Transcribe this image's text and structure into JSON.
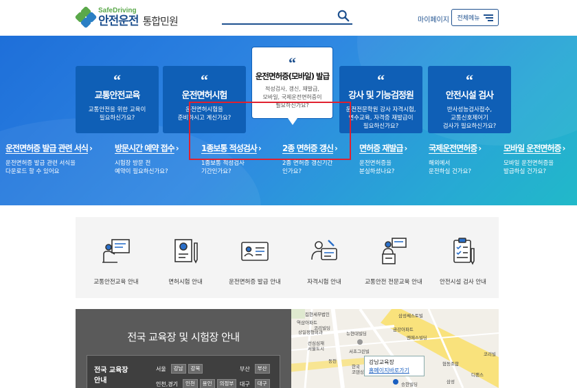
{
  "header": {
    "logo_en": "SafeDriving",
    "logo_ko": "안전운전",
    "logo_sub": "통합민원",
    "search_placeholder": "",
    "mypage": "마이페이지",
    "allmenu": "전체메뉴"
  },
  "colors": {
    "primary": "#1c4f8e",
    "card": "#0f5fb6",
    "highlight": "#e0202e",
    "logo_green": "#5aa84a"
  },
  "banner": {
    "cards": [
      {
        "title": "교통안전교육",
        "desc": "교통안전을 위한 교육이\n필요하신가요?"
      },
      {
        "title": "운전면허시험",
        "desc": "운전면허시험을\n준비하시고 계신가요?"
      },
      {
        "title": "운전면허증(모바일) 발급",
        "desc": "적성검사, 갱신, 재발급,\n모바일, 국제운전면허증이\n필요하신가요?"
      },
      {
        "title": "강사 및 기능검정원",
        "desc": "운전전문학원 강사 자격시험,\n연수교육, 자격증 재발급이\n필요하신가요?"
      },
      {
        "title": "안전시설 검사",
        "desc": "반사성능검사접수,\n교통신호제어기\n검사가 필요하신가요?"
      }
    ],
    "subs": [
      {
        "title": "운전면허증 발급 관련 서식",
        "desc": "운전면허증 발급 관련 서식을\n다운로드 할 수 있어요"
      },
      {
        "title": "방문시간 예약 접수",
        "desc": "시험장 방문 전\n예약이 필요하신가요?"
      },
      {
        "title": "1종보통 적성검사",
        "desc": "1종보통 적성검사\n기간인가요?"
      },
      {
        "title": "2종 면허증 갱신",
        "desc": "2종 면허증 갱신기간\n인가요?"
      },
      {
        "title": "면허증 재발급",
        "desc": "운전면허증을\n분실하셨나요?"
      },
      {
        "title": "국제운전면허증",
        "desc": "해외에서\n운전하실 건가요?"
      },
      {
        "title": "모바일 운전면허증",
        "desc": "모바일 운전면허증을\n발급하실 건가요?"
      }
    ]
  },
  "services": [
    {
      "label": "교통안전교육 안내",
      "icon": "teacher-board-icon"
    },
    {
      "label": "면허시험 안내",
      "icon": "exam-paper-icon"
    },
    {
      "label": "운전면허증 발급 안내",
      "icon": "license-card-icon"
    },
    {
      "label": "자격시험 안내",
      "icon": "qualification-exam-icon"
    },
    {
      "label": "교통안전 전문교육 안내",
      "icon": "lecturer-podium-icon"
    },
    {
      "label": "안전시설 검사 안내",
      "icon": "checklist-icon"
    }
  ],
  "guide": {
    "title": "전국 교육장 및 시험장 안내",
    "box_title": "전국 교육장\n안내",
    "regions": [
      {
        "name": "서울",
        "chips": [
          "강남",
          "강북"
        ]
      },
      {
        "name": "부산",
        "chips": [
          "부산"
        ]
      },
      {
        "name": "인천,경기",
        "chips": [
          "인천",
          "용인",
          "의정부"
        ]
      },
      {
        "name": "대구",
        "chips": [
          "대구"
        ]
      }
    ]
  },
  "map": {
    "labels": [
      "집현세무법인",
      "삼성쌔스토빌",
      "역삼아파트",
      "코리빌딩",
      "뉴현대빌딩",
      "금강아파트",
      "엔에스빌딩",
      "상일정형외과",
      "선심심재",
      "서울도시",
      "서초그린빌",
      "동천",
      "한국",
      "코덴싱그",
      "협동조합",
      "승한빌딩",
      "삼성",
      "디팬스",
      "코리빌"
    ],
    "popup_title": "강남교육장",
    "popup_link": "홈페이지바로가기"
  }
}
